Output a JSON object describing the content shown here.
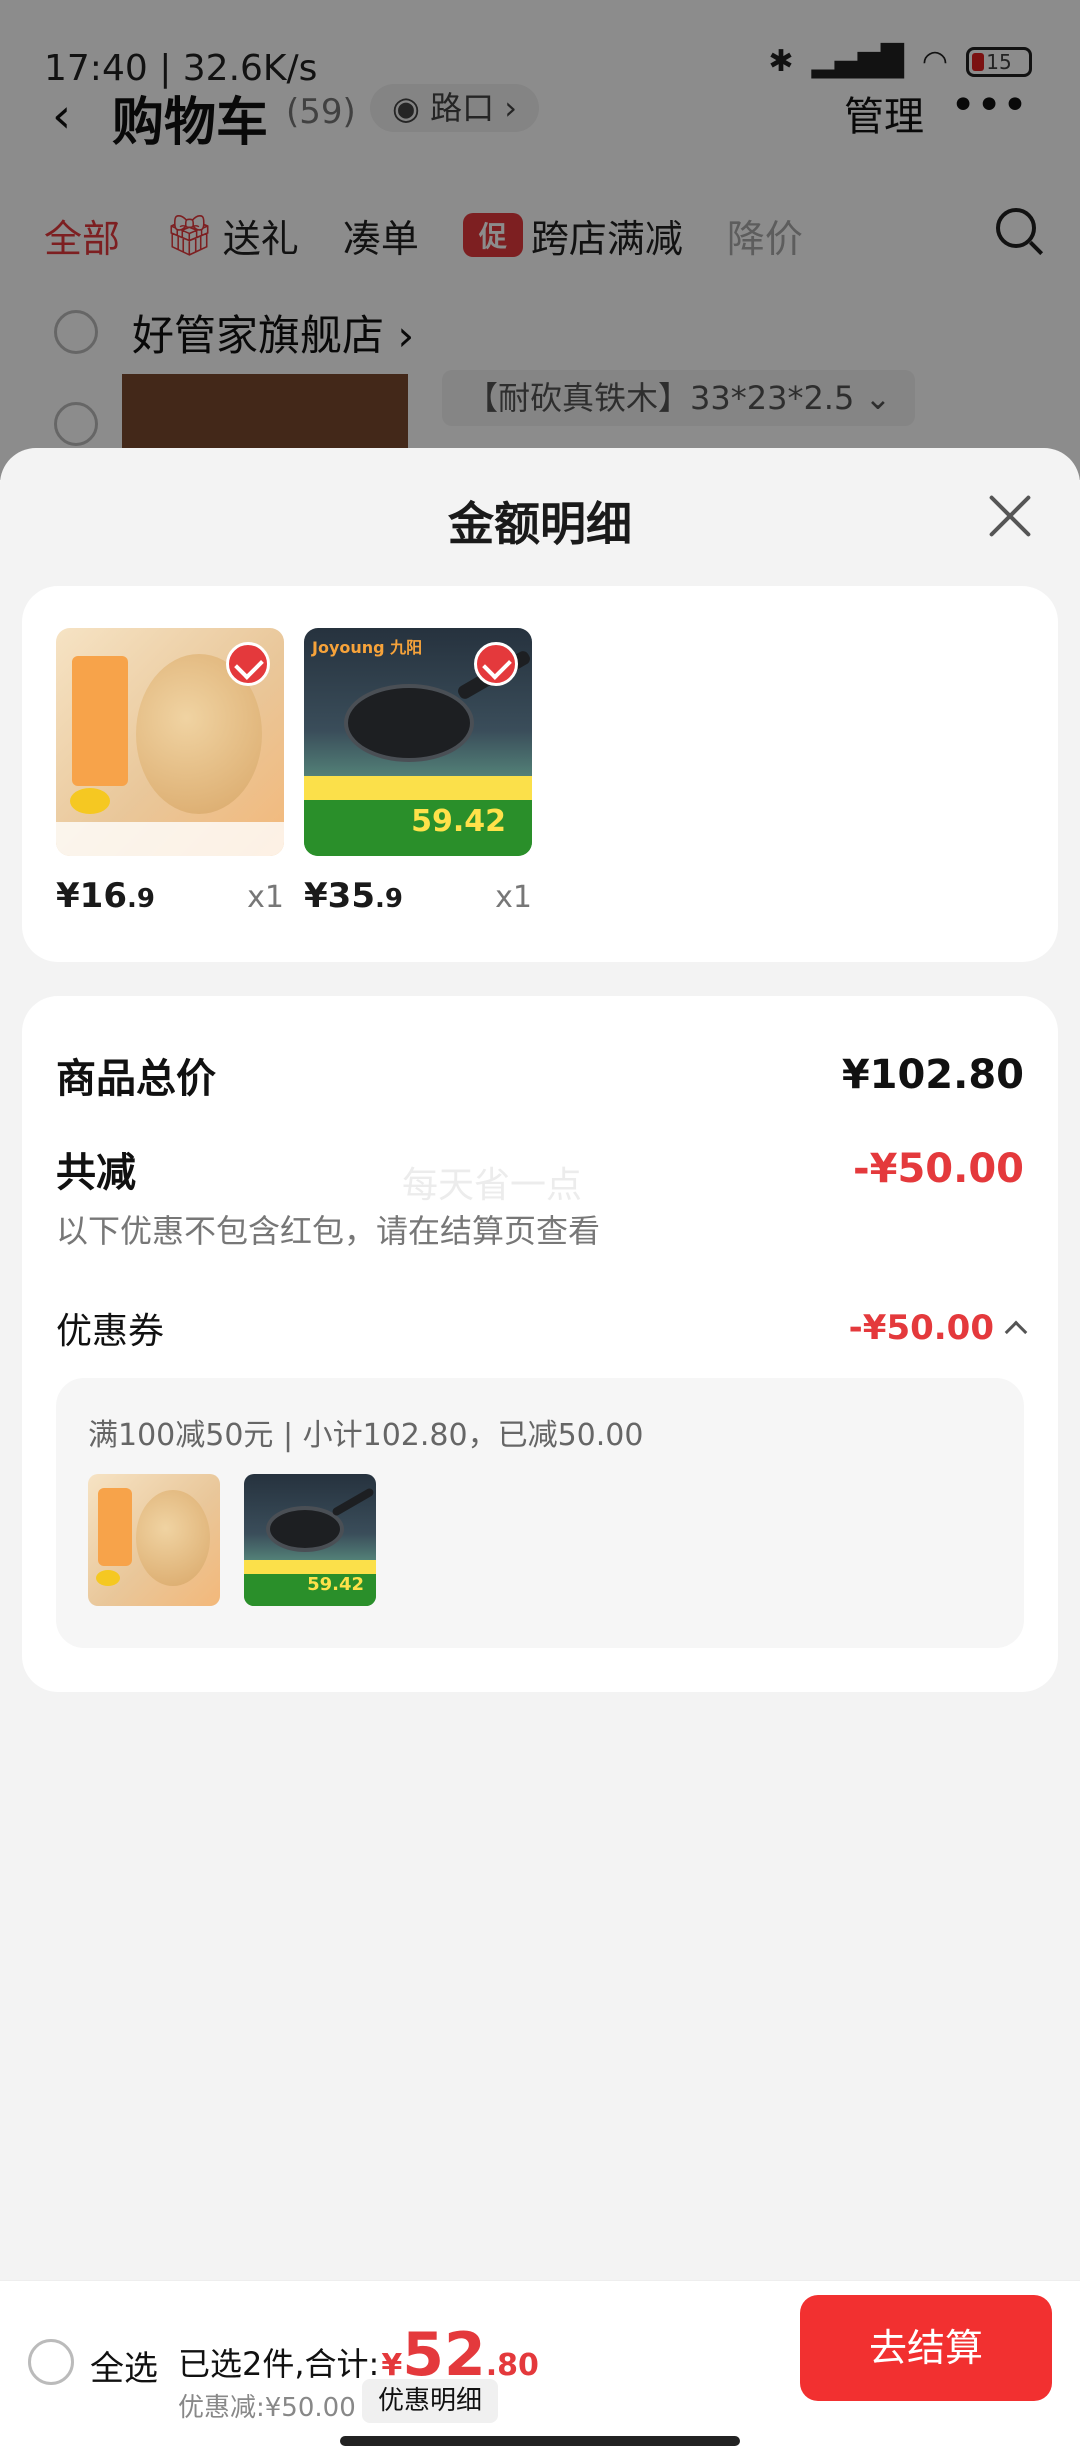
{
  "status_bar": {
    "time": "17:40 | 32.6K/s",
    "battery": "15"
  },
  "cart_header": {
    "title": "购物车",
    "count": "(59)",
    "location": "路口",
    "manage": "管理",
    "more": "•••"
  },
  "tabs": [
    {
      "label": "全部"
    },
    {
      "label": "送礼"
    },
    {
      "label": "凑单"
    },
    {
      "label": "跨店满减",
      "badge": "促"
    },
    {
      "label": "降价"
    }
  ],
  "shop": {
    "name": "好管家旗舰店",
    "spec": "【耐砍真铁木】33*23*2.5"
  },
  "sheet": {
    "title": "金额明细",
    "products": [
      {
        "price_int": "¥16",
        "price_dec": ".9",
        "qty": "x1"
      },
      {
        "price_int": "¥35",
        "price_dec": ".9",
        "qty": "x1"
      }
    ],
    "summary": {
      "total_label": "商品总价",
      "total_value": "¥102.80",
      "discount_label": "共减",
      "discount_value": "-¥50.00",
      "note": "以下优惠不包含红包，请在结算页查看",
      "watermark": "每天省一点",
      "coupon_label": "优惠券",
      "coupon_value": "-¥50.00",
      "coupon_detail": "满100减50元 | 小计102.80，已减50.00"
    }
  },
  "bottom_bar": {
    "select_all": "全选",
    "selected_text": "已选2件,合计:",
    "currency": "¥",
    "total_int": "52",
    "total_dec": ".80",
    "discount_text": "优惠减:¥50.00",
    "detail_button": "优惠明细",
    "checkout_button": "去结算"
  },
  "colors": {
    "accent": "#e4393c",
    "checkout": "#f23030"
  }
}
